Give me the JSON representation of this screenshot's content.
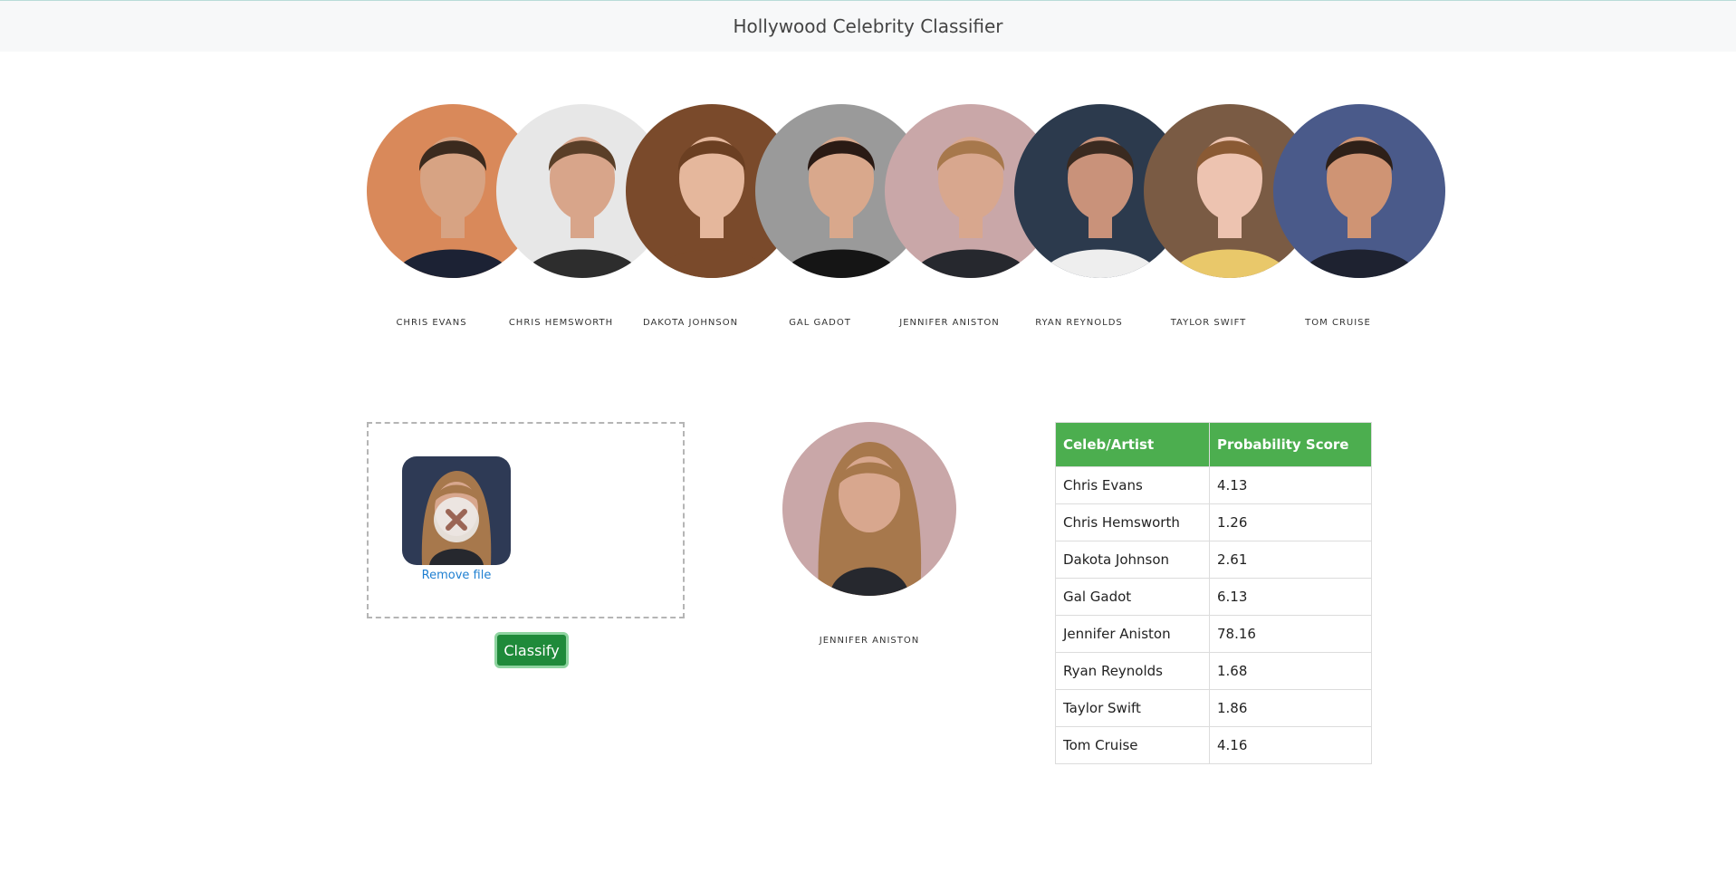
{
  "navbar": {
    "title": "Hollywood Celebrity Classifier"
  },
  "celebrities": [
    {
      "name": "Chris Evans",
      "icon": "chris-evans-photo",
      "skin": "#d7a383",
      "hair": "#3b2a1e",
      "bg": "#d9895a",
      "shirt": "#1c2234"
    },
    {
      "name": "Chris Hemsworth",
      "icon": "chris-hemsworth-photo",
      "skin": "#d8a58a",
      "hair": "#5a3f28",
      "bg": "#e7e7e7",
      "shirt": "#2d2d2d"
    },
    {
      "name": "Dakota Johnson",
      "icon": "dakota-johnson-photo",
      "skin": "#e5b79c",
      "hair": "#6b3f22",
      "bg": "#7a4a2b",
      "shirt": "#7a4a2b"
    },
    {
      "name": "Gal Gadot",
      "icon": "gal-gadot-photo",
      "skin": "#d9a88c",
      "hair": "#2a1a14",
      "bg": "#9a9a9a",
      "shirt": "#151515"
    },
    {
      "name": "Jennifer Aniston",
      "icon": "jennifer-aniston-photo",
      "skin": "#d8a78e",
      "hair": "#a7784c",
      "bg": "#c9a7a8",
      "shirt": "#26282e"
    },
    {
      "name": "Ryan Reynolds",
      "icon": "ryan-reynolds-photo",
      "skin": "#c9927a",
      "hair": "#3a2a20",
      "bg": "#2c3a4d",
      "shirt": "#eeeeee"
    },
    {
      "name": "Taylor Swift",
      "icon": "taylor-swift-photo",
      "skin": "#edc3b0",
      "hair": "#8a5a34",
      "bg": "#7a5b44",
      "shirt": "#e9c86a"
    },
    {
      "name": "Tom Cruise",
      "icon": "tom-cruise-photo",
      "skin": "#cf9474",
      "hair": "#2e2018",
      "bg": "#4a5a8a",
      "shirt": "#1e2230"
    }
  ],
  "upload": {
    "remove_label": "Remove file",
    "classify_label": "Classify",
    "thumb_icon": "uploaded-image-thumbnail"
  },
  "result": {
    "name": "Jennifer Aniston",
    "icon": "jennifer-aniston-photo"
  },
  "scores": {
    "headers": [
      "Celeb/Artist",
      "Probability Score"
    ],
    "rows": [
      [
        "Chris Evans",
        "4.13"
      ],
      [
        "Chris Hemsworth",
        "1.26"
      ],
      [
        "Dakota Johnson",
        "2.61"
      ],
      [
        "Gal Gadot",
        "6.13"
      ],
      [
        "Jennifer Aniston",
        "78.16"
      ],
      [
        "Ryan Reynolds",
        "1.68"
      ],
      [
        "Taylor Swift",
        "1.86"
      ],
      [
        "Tom Cruise",
        "4.16"
      ]
    ]
  },
  "colors": {
    "table_header": "#4cae4f",
    "button": "#1f8a3a",
    "link": "#1e7fd1"
  }
}
